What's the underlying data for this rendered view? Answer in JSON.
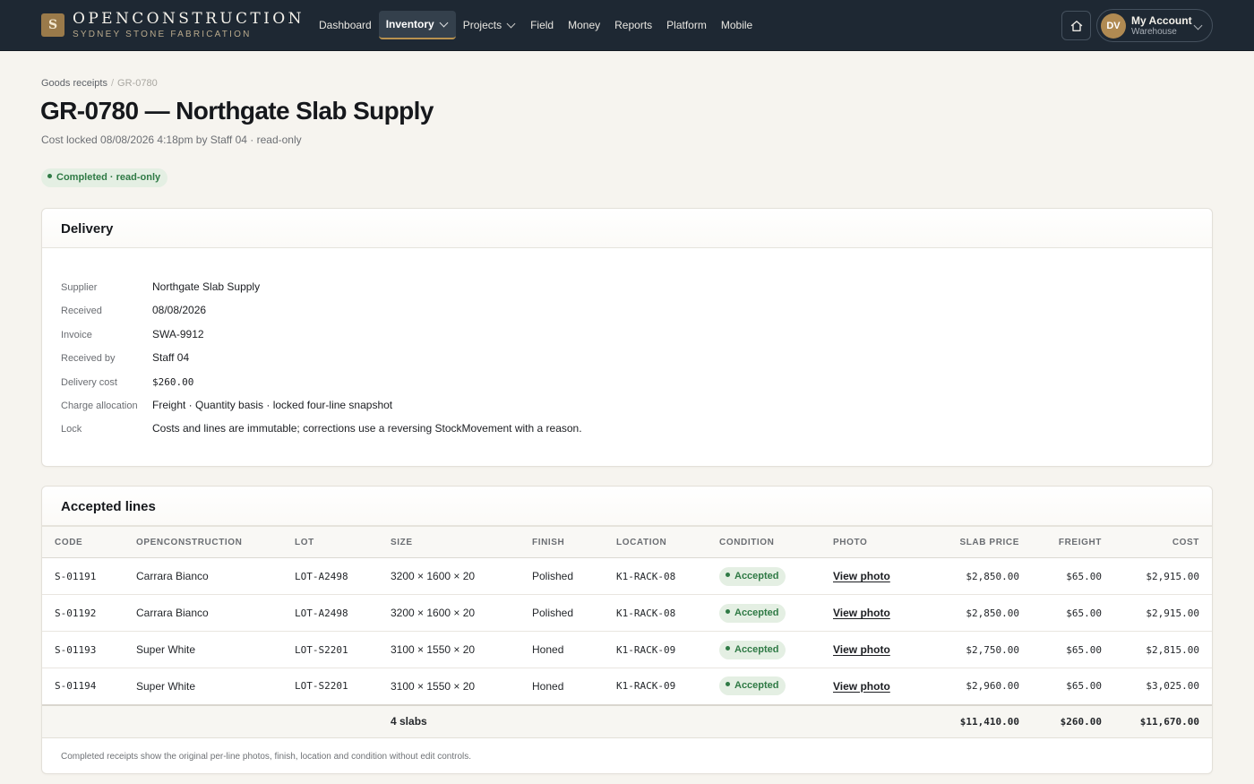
{
  "brand": {
    "mark": "S",
    "name": "OPENCONSTRUCTION",
    "subtitle": "SYDNEY STONE FABRICATION"
  },
  "nav": [
    {
      "label": "Dashboard",
      "has_menu": false,
      "active": false
    },
    {
      "label": "Inventory",
      "has_menu": true,
      "active": true
    },
    {
      "label": "Projects",
      "has_menu": true,
      "active": false
    },
    {
      "label": "Field",
      "has_menu": false,
      "active": false
    },
    {
      "label": "Money",
      "has_menu": false,
      "active": false
    },
    {
      "label": "Reports",
      "has_menu": false,
      "active": false
    },
    {
      "label": "Platform",
      "has_menu": false,
      "active": false
    },
    {
      "label": "Mobile",
      "has_menu": false,
      "active": false
    }
  ],
  "account": {
    "initials": "DV",
    "name": "My Account",
    "role": "Warehouse"
  },
  "breadcrumb": {
    "parent": "Goods receipts",
    "separator": "/",
    "current": "GR-0780"
  },
  "page": {
    "title": "GR-0780 — Northgate Slab Supply",
    "meta": "Cost locked 08/08/2026 4:18pm by Staff 04 · read-only",
    "status": "Completed · read-only"
  },
  "delivery": {
    "heading": "Delivery",
    "rows": [
      {
        "key": "Supplier",
        "value": "Northgate Slab Supply"
      },
      {
        "key": "Received",
        "value": "08/08/2026"
      },
      {
        "key": "Invoice",
        "value": "SWA-9912"
      },
      {
        "key": "Received by",
        "value": "Staff 04"
      },
      {
        "key": "Delivery cost",
        "value": "$260.00"
      },
      {
        "key": "Charge allocation",
        "value": "Freight · Quantity basis · locked four-line snapshot"
      },
      {
        "key": "Lock",
        "value": "Costs and lines are immutable; corrections use a reversing StockMovement with a reason."
      }
    ]
  },
  "lines": {
    "heading": "Accepted lines",
    "columns": [
      "CODE",
      "OPENCONSTRUCTION",
      "LOT",
      "SIZE",
      "FINISH",
      "LOCATION",
      "CONDITION",
      "PHOTO",
      "SLAB PRICE",
      "FREIGHT",
      "COST"
    ],
    "rows": [
      {
        "code": "S-01191",
        "material": "Carrara Bianco",
        "lot": "LOT-A2498",
        "size": "3200 × 1600 × 20",
        "finish": "Polished",
        "location": "K1-RACK-08",
        "condition": "Accepted",
        "photo": "View photo",
        "slab_price": "$2,850.00",
        "freight": "$65.00",
        "cost": "$2,915.00"
      },
      {
        "code": "S-01192",
        "material": "Carrara Bianco",
        "lot": "LOT-A2498",
        "size": "3200 × 1600 × 20",
        "finish": "Polished",
        "location": "K1-RACK-08",
        "condition": "Accepted",
        "photo": "View photo",
        "slab_price": "$2,850.00",
        "freight": "$65.00",
        "cost": "$2,915.00"
      },
      {
        "code": "S-01193",
        "material": "Super White",
        "lot": "LOT-S2201",
        "size": "3100 × 1550 × 20",
        "finish": "Honed",
        "location": "K1-RACK-09",
        "condition": "Accepted",
        "photo": "View photo",
        "slab_price": "$2,750.00",
        "freight": "$65.00",
        "cost": "$2,815.00"
      },
      {
        "code": "S-01194",
        "material": "Super White",
        "lot": "LOT-S2201",
        "size": "3100 × 1550 × 20",
        "finish": "Honed",
        "location": "K1-RACK-09",
        "condition": "Accepted",
        "photo": "View photo",
        "slab_price": "$2,960.00",
        "freight": "$65.00",
        "cost": "$3,025.00"
      }
    ],
    "totals": {
      "count": "4 slabs",
      "slab_price": "$11,410.00",
      "freight": "$260.00",
      "cost": "$11,670.00"
    },
    "note": "Completed receipts show the original per-line photos, finish, location and condition without edit controls."
  },
  "colors": {
    "topbar": "#1e2833",
    "accent": "#b8924f",
    "background": "#f6f4ef",
    "status_green": "#2f7a45",
    "status_green_bg": "#e4efe3"
  },
  "icons": {
    "home": "home-icon",
    "menu": "chevron-down-icon",
    "status": "dot-icon"
  }
}
